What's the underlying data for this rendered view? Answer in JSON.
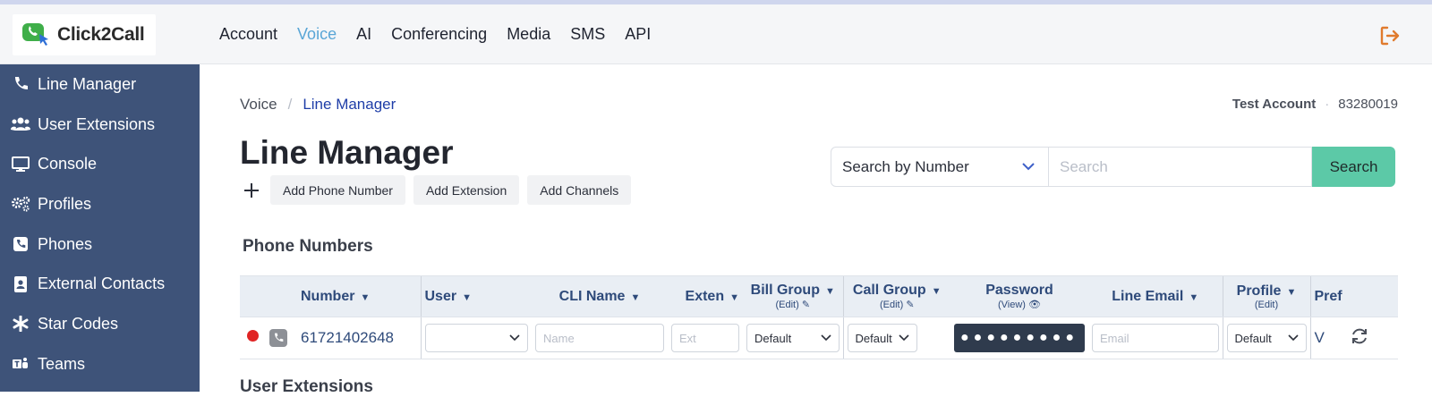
{
  "app": {
    "logo_text": "Click2Call"
  },
  "topnav": {
    "items": [
      "Account",
      "Voice",
      "AI",
      "Conferencing",
      "Media",
      "SMS",
      "API"
    ],
    "active": "Voice"
  },
  "sidebar": {
    "items": [
      {
        "label": "Line Manager",
        "icon": "phone-icon"
      },
      {
        "label": "User Extensions",
        "icon": "users-icon"
      },
      {
        "label": "Console",
        "icon": "monitor-icon"
      },
      {
        "label": "Profiles",
        "icon": "gears-icon"
      },
      {
        "label": "Phones",
        "icon": "phone-square-icon"
      },
      {
        "label": "External Contacts",
        "icon": "contact-card-icon"
      },
      {
        "label": "Star Codes",
        "icon": "asterisk-icon"
      },
      {
        "label": "Teams",
        "icon": "teams-icon"
      }
    ]
  },
  "breadcrumb": {
    "root": "Voice",
    "separator": "/",
    "current": "Line Manager"
  },
  "account": {
    "name": "Test Account",
    "separator": "·",
    "number": "83280019"
  },
  "page_title": "Line Manager",
  "actions": {
    "add_phone": "Add Phone Number",
    "add_extension": "Add Extension",
    "add_channels": "Add Channels"
  },
  "search": {
    "mode": "Search by Number",
    "placeholder": "Search",
    "button": "Search"
  },
  "phone_numbers": {
    "title": "Phone Numbers",
    "columns": {
      "number": "Number",
      "user": "User",
      "cli_name": "CLI Name",
      "exten": "Exten",
      "bill_group": "Bill Group",
      "bill_group_sub": "(Edit)",
      "call_group": "Call Group",
      "call_group_sub": "(Edit)",
      "password": "Password",
      "password_sub": "(View)",
      "line_email": "Line Email",
      "profile": "Profile",
      "profile_sub": "(Edit)",
      "pref": "Pref"
    },
    "rows": [
      {
        "number": "61721402648",
        "user": "",
        "cli_placeholder": "Name",
        "ext_placeholder": "Ext",
        "bill_group": "Default",
        "call_group": "Default",
        "password_mask": "●●●●●●●●●",
        "email_placeholder": "Email",
        "profile": "Default",
        "pref": "V"
      }
    ]
  },
  "next_section_partial": "User Extensions",
  "colors": {
    "sidebar": "#3e5379",
    "accent_nav": "#5aa6d6",
    "search_button": "#5cc9a7",
    "status_red": "#e02424",
    "logout": "#e07b2e"
  }
}
